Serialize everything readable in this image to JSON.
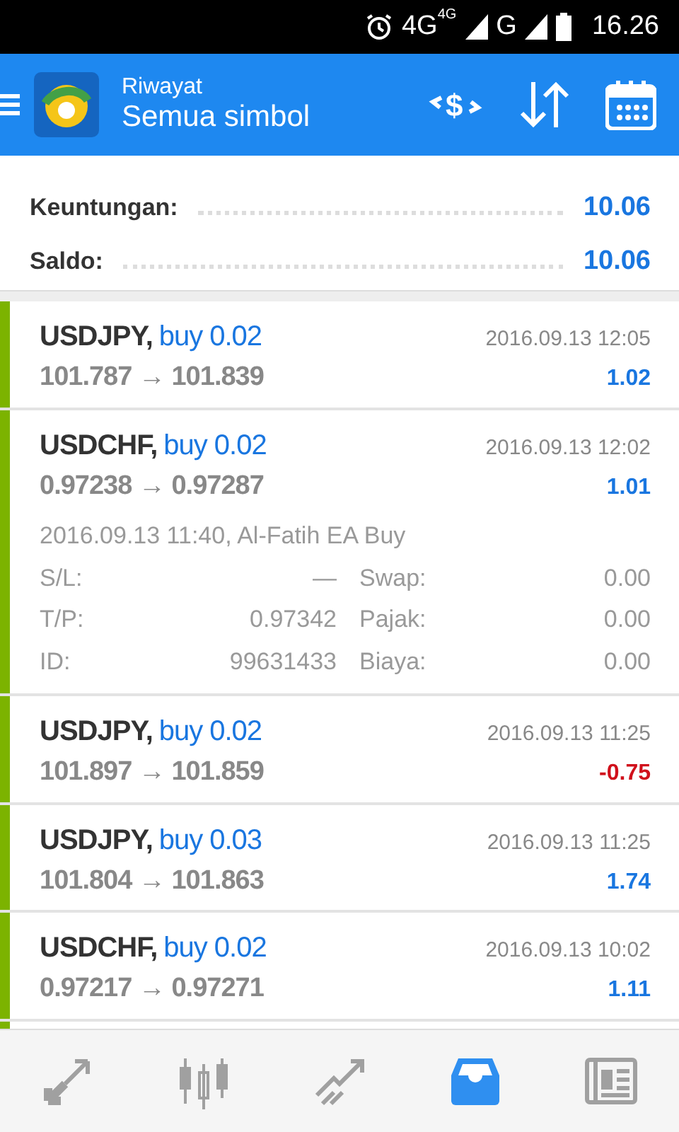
{
  "status_bar": {
    "network_small": "4G",
    "network": "4G",
    "network2": "G",
    "time": "16.26"
  },
  "app_bar": {
    "title": "Riwayat",
    "subtitle": "Semua simbol",
    "exchange_symbol": "$"
  },
  "summary": [
    {
      "label": "Keuntungan:",
      "value": "10.06"
    },
    {
      "label": "Saldo:",
      "value": "10.06"
    }
  ],
  "trades": [
    {
      "kind": "buy",
      "symbol": "USDJPY,",
      "side": "buy 0.02",
      "prices": "101.787 → 101.839",
      "time": "2016.09.13 12:05",
      "profit": "1.02",
      "color": "#1976e0",
      "expanded": false
    },
    {
      "kind": "buy",
      "symbol": "USDCHF,",
      "side": "buy 0.02",
      "prices": "0.97238 → 0.97287",
      "time": "2016.09.13 12:02",
      "profit": "1.01",
      "color": "#1976e0",
      "expanded": true,
      "comment": "2016.09.13 11:40, Al-Fatih EA Buy",
      "details": [
        {
          "label": "S/L:",
          "value": "—",
          "label2": "Swap:",
          "value2": "0.00"
        },
        {
          "label": "T/P:",
          "value": "0.97342",
          "label2": "Pajak:",
          "value2": "0.00"
        },
        {
          "label": "ID:",
          "value": "99631433",
          "label2": "Biaya:",
          "value2": "0.00"
        }
      ]
    },
    {
      "kind": "buy",
      "symbol": "USDJPY,",
      "side": "buy 0.02",
      "prices": "101.897 → 101.859",
      "time": "2016.09.13 11:25",
      "profit": "-0.75",
      "color": "#d0101b",
      "expanded": false
    },
    {
      "kind": "buy",
      "symbol": "USDJPY,",
      "side": "buy 0.03",
      "prices": "101.804 → 101.863",
      "time": "2016.09.13 11:25",
      "profit": "1.74",
      "color": "#1976e0",
      "expanded": false
    },
    {
      "kind": "buy",
      "symbol": "USDCHF,",
      "side": "buy 0.02",
      "prices": "0.97217 → 0.97271",
      "time": "2016.09.13 10:02",
      "profit": "1.11",
      "color": "#1976e0",
      "expanded": false
    }
  ],
  "bottom_nav": [
    {
      "selected": false
    },
    {
      "selected": false
    },
    {
      "selected": false
    },
    {
      "selected": true
    },
    {
      "selected": false
    }
  ]
}
